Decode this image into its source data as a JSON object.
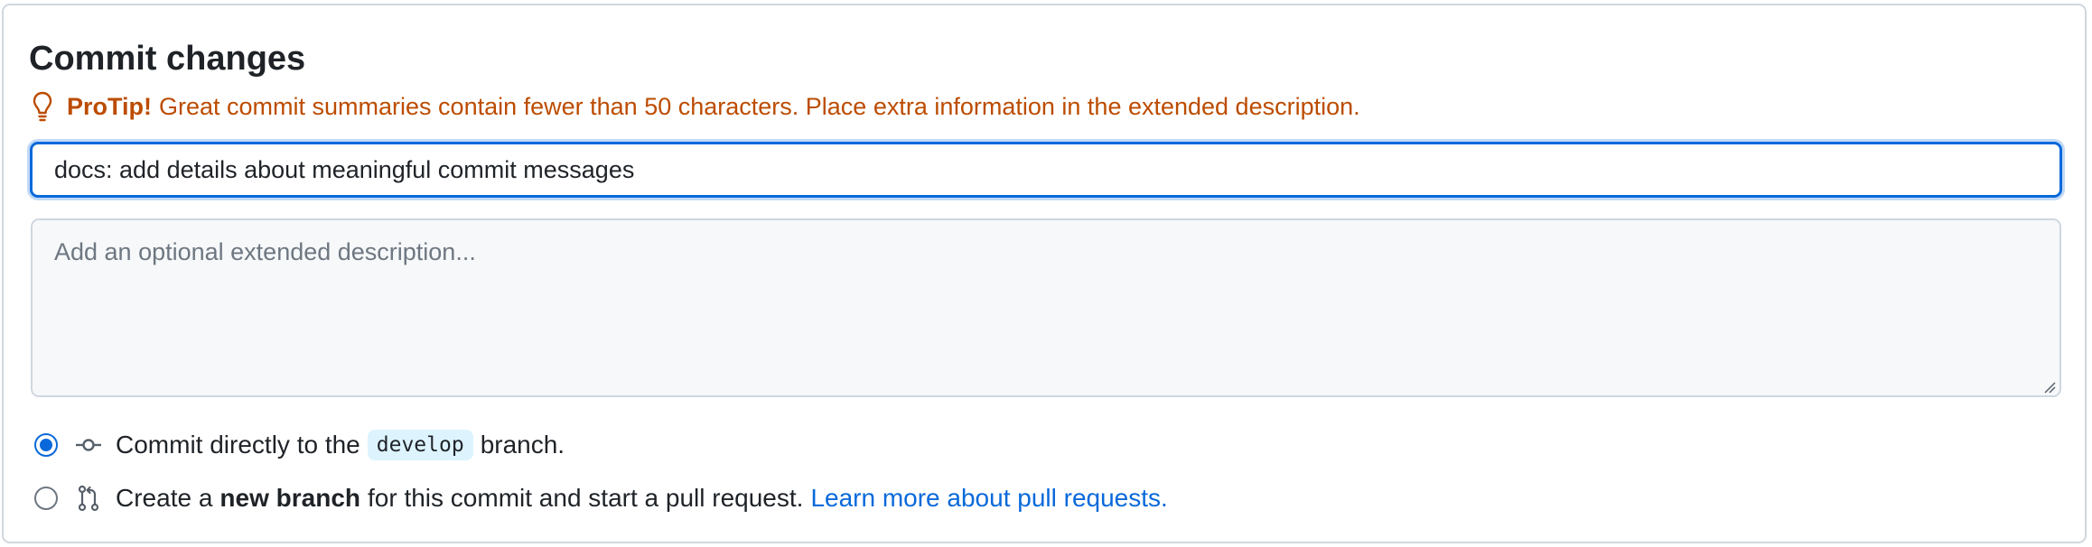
{
  "dialog": {
    "title": "Commit changes"
  },
  "protip": {
    "label": "ProTip!",
    "text": "Great commit summaries contain fewer than 50 characters. Place extra information in the extended description.",
    "icon": "lightbulb-icon",
    "color": "#bc4c00"
  },
  "summary": {
    "value": "docs: add details about meaningful commit messages"
  },
  "description": {
    "placeholder": "Add an optional extended description..."
  },
  "options": {
    "selected": "commit-directly",
    "direct": {
      "prefix": "Commit directly to the",
      "branch": "develop",
      "suffix": "branch.",
      "icon": "git-commit-icon"
    },
    "new_branch": {
      "prefix": "Create a",
      "bold": "new branch",
      "suffix": "for this commit and start a pull request.",
      "link": "Learn more about pull requests.",
      "icon": "git-pull-request-icon"
    }
  },
  "colors": {
    "accent": "#0969da",
    "border": "#d0d7de",
    "code_bg": "#ddf4ff"
  }
}
